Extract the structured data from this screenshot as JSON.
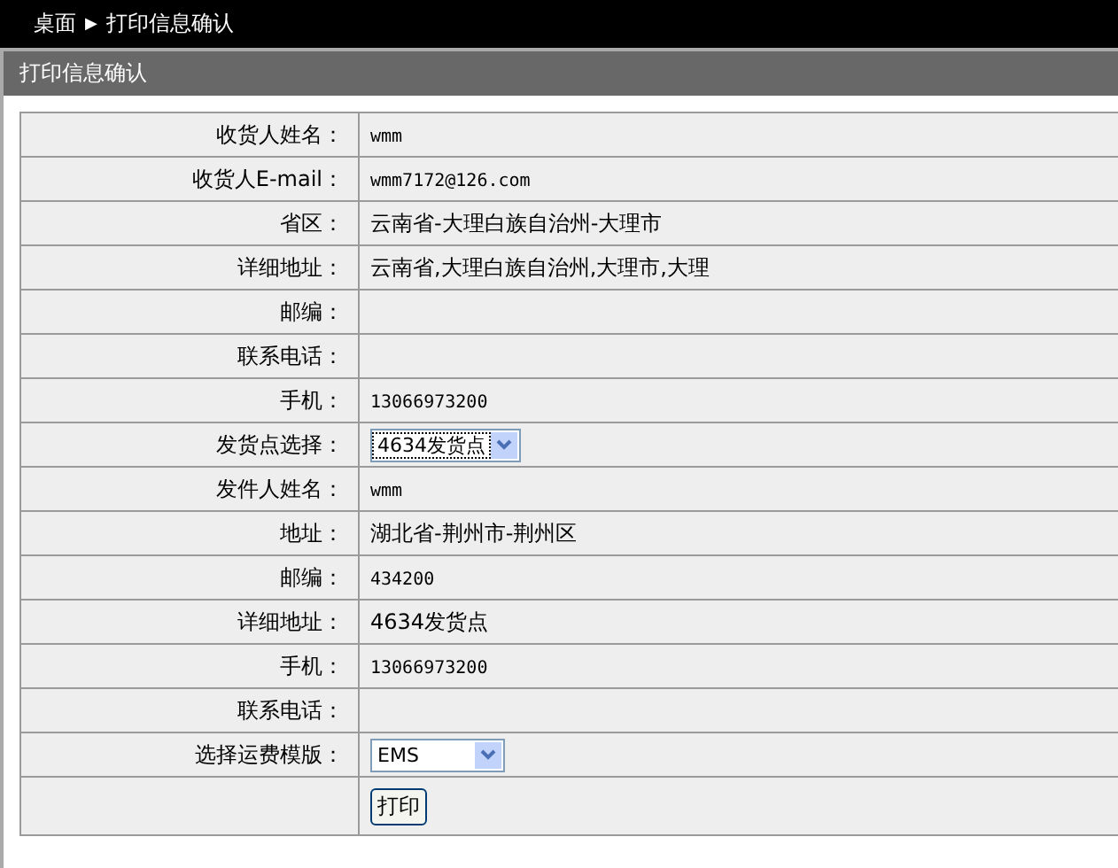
{
  "breadcrumb": {
    "home": "桌面",
    "separator": "▶",
    "current": "打印信息确认"
  },
  "panel": {
    "title": "打印信息确认"
  },
  "rows": [
    {
      "kind": "text",
      "label": "收货人姓名：",
      "value": "wmm"
    },
    {
      "kind": "text",
      "label": "收货人E-mail：",
      "value": "wmm7172@126.com"
    },
    {
      "kind": "text",
      "label": "省区：",
      "value": "云南省-大理白族自治州-大理市"
    },
    {
      "kind": "text",
      "label": "详细地址：",
      "value": "云南省,大理白族自治州,大理市,大理"
    },
    {
      "kind": "text",
      "label": "邮编："
    },
    {
      "kind": "text",
      "label": "联系电话："
    },
    {
      "kind": "text",
      "label": "手机：",
      "value": "13066973200"
    },
    {
      "kind": "select",
      "label": "发货点选择：",
      "value": "4634发货点",
      "focused": true
    },
    {
      "kind": "text",
      "label": "发件人姓名：",
      "value": "wmm"
    },
    {
      "kind": "text",
      "label": "地址：",
      "value": "湖北省-荆州市-荆州区"
    },
    {
      "kind": "text",
      "label": "邮编：",
      "value": "434200"
    },
    {
      "kind": "text",
      "label": "详细地址：",
      "value": "4634发货点"
    },
    {
      "kind": "text",
      "label": "手机：",
      "value": "13066973200"
    },
    {
      "kind": "text",
      "label": "联系电话："
    },
    {
      "kind": "select",
      "label": "选择运费模版：",
      "value": "EMS",
      "focused": false
    },
    {
      "kind": "button",
      "value": "打印"
    }
  ]
}
